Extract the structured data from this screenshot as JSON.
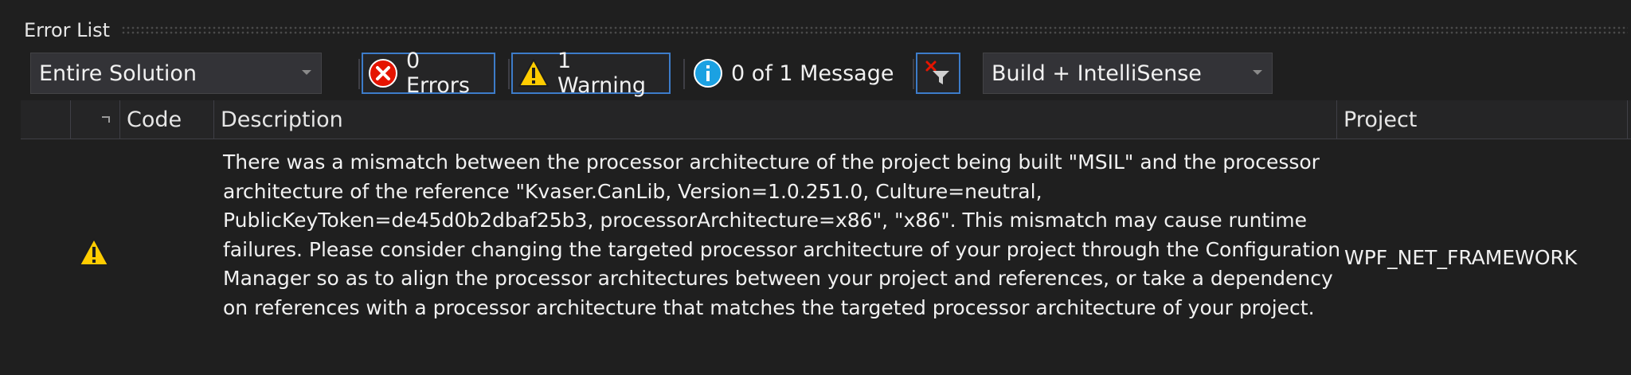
{
  "panel": {
    "title": "Error List"
  },
  "toolbar": {
    "scope": {
      "selected": "Entire Solution"
    },
    "errors": {
      "label": "0 Errors",
      "icon": "error-icon",
      "active": true
    },
    "warnings": {
      "label": "1 Warning",
      "icon": "warning-icon",
      "active": true
    },
    "messages": {
      "label": "0 of 1 Message",
      "icon": "info-icon",
      "active": false
    },
    "filter": {
      "icon": "clear-filter-icon"
    },
    "source": {
      "selected": "Build + IntelliSense"
    }
  },
  "columns": {
    "code": "Code",
    "description": "Description",
    "project": "Project"
  },
  "rows": [
    {
      "severity_icon": "warning-icon",
      "code": "",
      "description": "There was a mismatch between the processor architecture of the project being built \"MSIL\" and the processor architecture of the reference \"Kvaser.CanLib, Version=1.0.251.0, Culture=neutral, PublicKeyToken=de45d0b2dbaf25b3, processorArchitecture=x86\", \"x86\". This mismatch may cause runtime failures. Please consider changing the targeted processor architecture of your project through the Configuration Manager so as to align the processor architectures between your project and references, or take a dependency on references with a processor architecture that matches the targeted processor architecture of your project.",
      "project": "WPF_NET_FRAMEWORK"
    }
  ],
  "colors": {
    "background": "#1f1f1f",
    "accent_border": "#3d7cc9",
    "error_red": "#e51400",
    "warning_yellow": "#ffcc00",
    "info_blue": "#1ba1e2"
  }
}
